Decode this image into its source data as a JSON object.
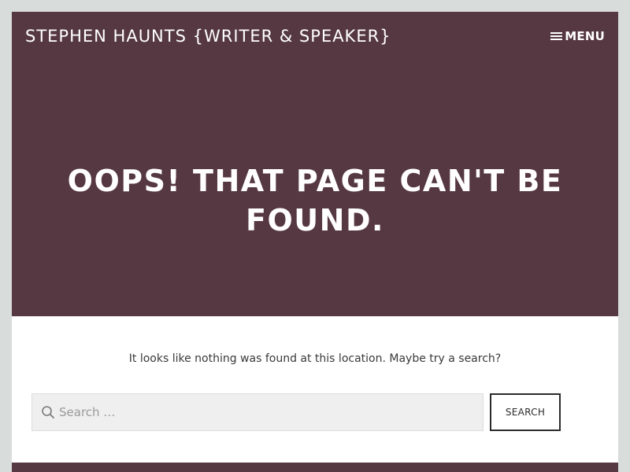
{
  "site": {
    "title": "STEPHEN HAUNTS {WRITER & SPEAKER}"
  },
  "header": {
    "menu_label": "MENU",
    "menu_icon": "hamburger-icon"
  },
  "hero": {
    "heading": "OOPS! THAT PAGE CAN'T BE FOUND."
  },
  "content": {
    "message": "It looks like nothing was found at this location. Maybe try a search?"
  },
  "search": {
    "placeholder": "Search …",
    "value": "",
    "button_label": "SEARCH",
    "icon": "search-icon"
  },
  "colors": {
    "page_background": "#d8dcdb",
    "brand": "#563842",
    "text": "#3a3a3a",
    "input_background": "#efefef",
    "button_border": "#2b2b2b"
  }
}
